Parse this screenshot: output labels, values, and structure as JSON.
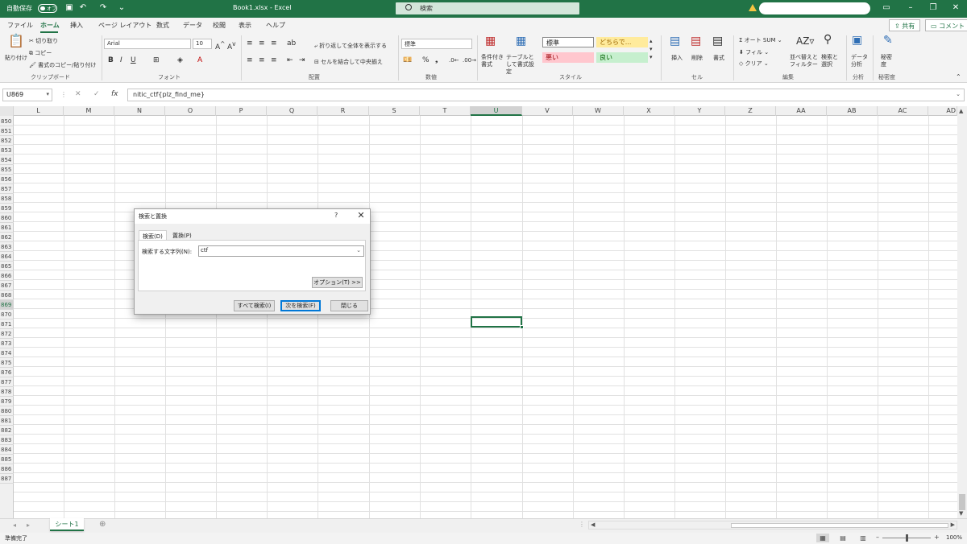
{
  "titlebar": {
    "autosave_label": "自動保存",
    "autosave_state": "オフ",
    "filename": "Book1.xlsx  -  Excel",
    "search_placeholder": "検索"
  },
  "menu": {
    "tabs": [
      "ファイル",
      "ホーム",
      "挿入",
      "ページ レイアウト",
      "数式",
      "データ",
      "校閲",
      "表示",
      "ヘルプ"
    ],
    "active": "ホーム",
    "share": "共有",
    "comment": "コメント"
  },
  "ribbon": {
    "clipboard": {
      "paste": "貼り付け",
      "cut": "切り取り",
      "copy": "コピー",
      "format_painter": "書式のコピー/貼り付け",
      "label": "クリップボード"
    },
    "font": {
      "name": "Arial",
      "size": "10",
      "label": "フォント"
    },
    "alignment": {
      "wrap": "折り返して全体を表示する",
      "merge": "セルを結合して中央揃え",
      "label": "配置"
    },
    "number": {
      "format": "標準",
      "label": "数値"
    },
    "styles": {
      "conditional": "条件付き書式",
      "table": "テーブルとして書式設定",
      "cells": [
        {
          "text": "標準",
          "bg": "#ffffff",
          "color": "#222222"
        },
        {
          "text": "どちらで...",
          "bg": "#ffeb9c",
          "color": "#9c6500"
        },
        {
          "text": "悪い",
          "bg": "#ffc7ce",
          "color": "#9c0006"
        },
        {
          "text": "良い",
          "bg": "#c6efce",
          "color": "#006100"
        }
      ],
      "label": "スタイル"
    },
    "cells_group": {
      "insert": "挿入",
      "delete": "削除",
      "format": "書式",
      "label": "セル"
    },
    "editing": {
      "autosum": "オート SUM",
      "fill": "フィル",
      "clear": "クリア",
      "sort": "並べ替えとフィルター",
      "find": "検索と選択",
      "label": "編集"
    },
    "analysis": {
      "analyze": "データ分析",
      "label": "分析"
    },
    "sensitivity": {
      "text": "秘密度",
      "label": "秘密度"
    }
  },
  "formula": {
    "namebox": "U869",
    "content": "nitic_ctf{plz_find_me}"
  },
  "grid": {
    "columns": [
      "L",
      "M",
      "N",
      "O",
      "P",
      "Q",
      "R",
      "S",
      "T",
      "U",
      "V",
      "W",
      "X",
      "Y",
      "Z",
      "AA",
      "AB",
      "AC",
      "AD"
    ],
    "selected_column": "U",
    "rows": [
      "850",
      "851",
      "852",
      "853",
      "854",
      "855",
      "856",
      "857",
      "858",
      "859",
      "860",
      "861",
      "862",
      "863",
      "864",
      "865",
      "866",
      "867",
      "868",
      "869",
      "870",
      "871",
      "872",
      "873",
      "874",
      "875",
      "876",
      "877",
      "878",
      "879",
      "880",
      "881",
      "882",
      "883",
      "884",
      "885",
      "886",
      "887"
    ],
    "selected_row": "869"
  },
  "sheets": {
    "active": "シート1"
  },
  "status": {
    "ready": "準備完了",
    "zoom": "100%"
  },
  "dialog": {
    "title": "検索と置換",
    "help": "?",
    "tab_find": "検索(D)",
    "tab_replace": "置換(P)",
    "find_label": "検索する文字列(N):",
    "find_value": "ctf",
    "options": "オプション(T) >>",
    "find_all": "すべて検索(I)",
    "find_next": "次を検索(F)",
    "close": "閉じる"
  },
  "colors": {
    "accent": "#217346"
  }
}
